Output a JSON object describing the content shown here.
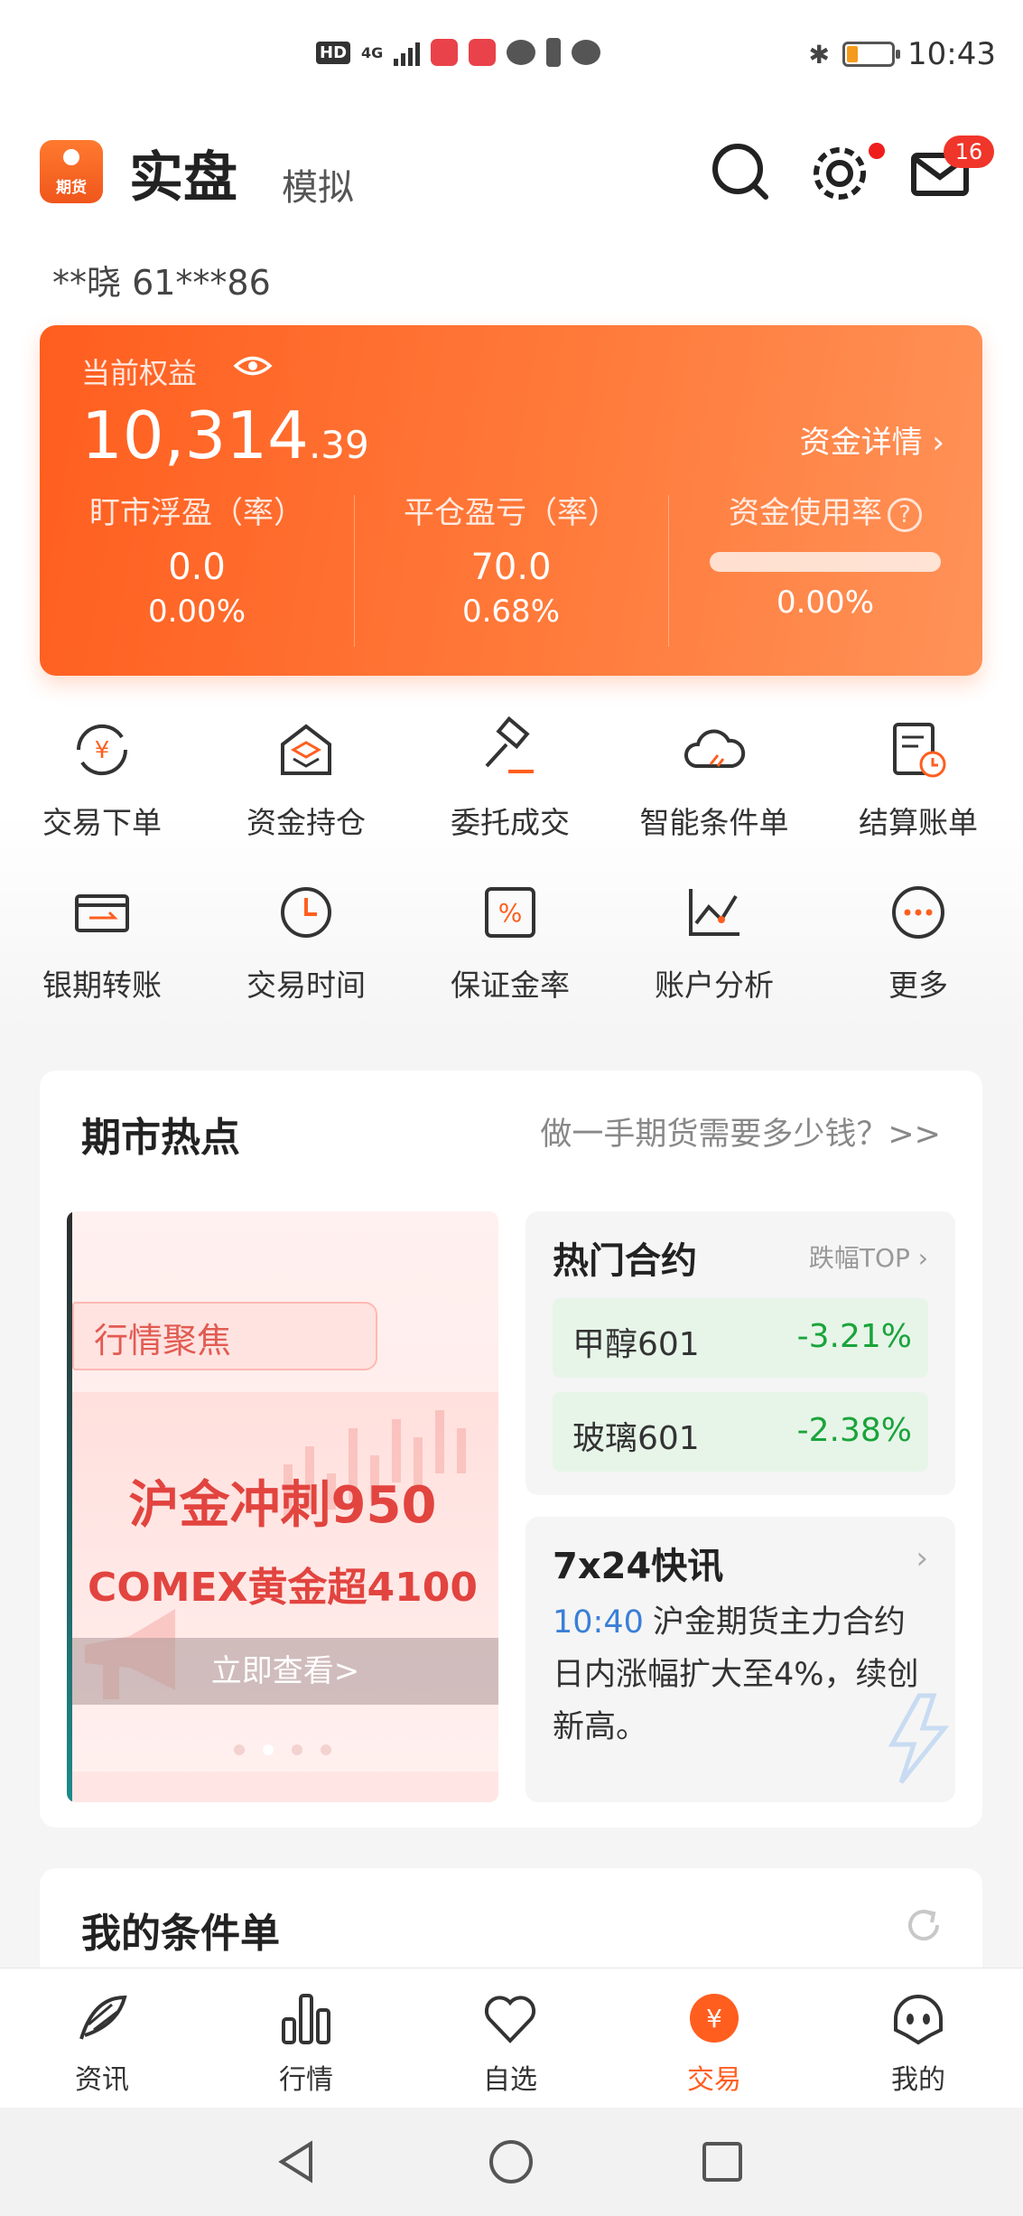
{
  "status_bar": {
    "network_label": "HD",
    "signal_label": "4G",
    "time": "10:43",
    "battery_level": 0.25
  },
  "header": {
    "logo_text": "期货",
    "tab_real": "实盘",
    "tab_sim": "模拟",
    "mail_badge": "16"
  },
  "account": {
    "text": "**晓  61***86"
  },
  "equity": {
    "label": "当前权益",
    "value_int": "10,314",
    "value_dec": ".39",
    "detail_link": "资金详情 ›",
    "floating_label": "盯市浮盈（率）",
    "floating_value": "0.0",
    "floating_rate": "0.00%",
    "closing_label": "平仓盈亏（率）",
    "closing_value": "70.0",
    "closing_rate": "0.68%",
    "usage_label": "资金使用率",
    "usage_help": "?",
    "usage_rate": "0.00%",
    "usage_fraction": 0.0
  },
  "quick_menu": [
    {
      "label": "交易下单",
      "icon": "yuan-cycle-icon"
    },
    {
      "label": "资金持仓",
      "icon": "layers-house-icon"
    },
    {
      "label": "委托成交",
      "icon": "gavel-icon"
    },
    {
      "label": "智能条件单",
      "icon": "cloud-icon"
    },
    {
      "label": "结算账单",
      "icon": "bill-clock-icon"
    },
    {
      "label": "银期转账",
      "icon": "transfer-card-icon"
    },
    {
      "label": "交易时间",
      "icon": "clock-icon"
    },
    {
      "label": "保证金率",
      "icon": "percent-icon"
    },
    {
      "label": "账户分析",
      "icon": "line-chart-icon"
    },
    {
      "label": "更多",
      "icon": "more-icon"
    }
  ],
  "hot": {
    "title": "期市热点",
    "link": "做一手期货需要多少钱？>>",
    "banner": {
      "tag": "行情聚焦",
      "headline1": "沪金冲刺950",
      "headline2": "COMEX黄金超4100",
      "button": "立即查看>"
    },
    "hot_contracts": {
      "title": "热门合约",
      "top_label": "跌幅TOP ›",
      "rows": [
        {
          "name": "甲醇601",
          "change": "-3.21%"
        },
        {
          "name": "玻璃601",
          "change": "-2.38%"
        }
      ]
    },
    "news": {
      "title": "7x24快讯",
      "arrow": "›",
      "time": "10:40",
      "text": "沪金期货主力合约日内涨幅扩大至4%，续创新高。"
    }
  },
  "conditions": {
    "title": "我的条件单"
  },
  "bottom_nav": [
    {
      "label": "资讯",
      "icon": "feather-icon"
    },
    {
      "label": "行情",
      "icon": "bar-chart-icon"
    },
    {
      "label": "自选",
      "icon": "heart-icon"
    },
    {
      "label": "交易",
      "icon": "yuan-circle-icon"
    },
    {
      "label": "我的",
      "icon": "ghost-face-icon"
    }
  ],
  "colors": {
    "accent": "#ff5e1f",
    "down": "#1aa43a",
    "time_blue": "#3a7fd6",
    "banner_red": "#e2443f"
  }
}
